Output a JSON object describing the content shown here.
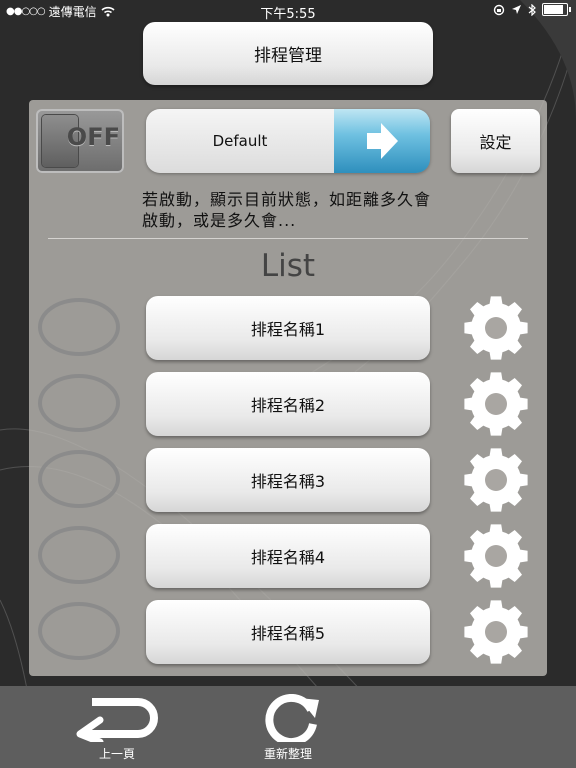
{
  "status_bar": {
    "carrier": "遠傳電信",
    "time": "下午5:55",
    "battery_level": 0.85
  },
  "title_button": "排程管理",
  "toggle": {
    "label": "OFF",
    "state": "off"
  },
  "schedule_selector": {
    "value": "Default",
    "icon": "arrow-right-icon"
  },
  "settings_button": "設定",
  "status_message": "若啟動，顯示目前狀態，如距離多久會啟動，或是多久會...",
  "list_title": "List",
  "schedules": [
    {
      "name": "排程名稱1",
      "icon": "gear-icon"
    },
    {
      "name": "排程名稱2",
      "icon": "gear-icon"
    },
    {
      "name": "排程名稱3",
      "icon": "gear-icon"
    },
    {
      "name": "排程名稱4",
      "icon": "gear-icon"
    },
    {
      "name": "排程名稱5",
      "icon": "gear-icon"
    }
  ],
  "toolbar": {
    "back": {
      "label": "上一頁",
      "icon": "back-arrow-icon"
    },
    "refresh": {
      "label": "重新整理",
      "icon": "refresh-icon"
    }
  },
  "colors": {
    "accent": "#2e8fbd",
    "panel": "#b7b4b0",
    "toolbar": "#5e5e5e"
  }
}
